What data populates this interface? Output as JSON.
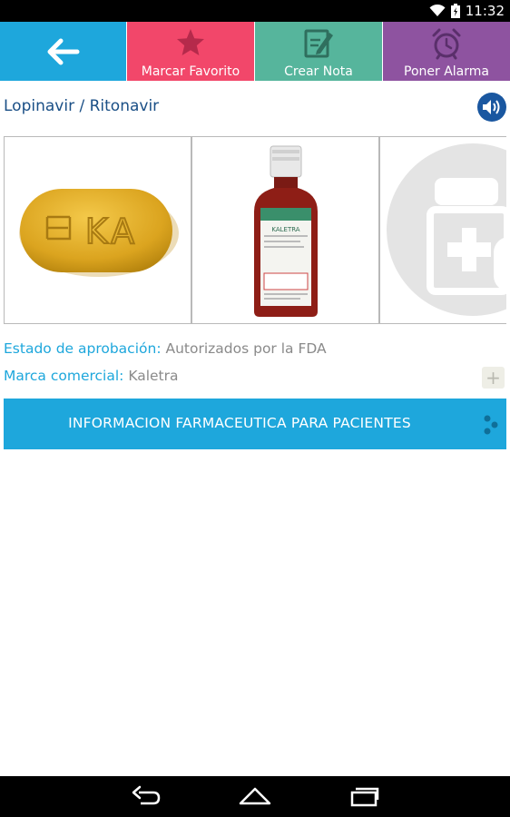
{
  "status_bar": {
    "time": "11:32",
    "icons": [
      "wifi-icon",
      "battery-icon"
    ]
  },
  "toolbar": {
    "back_icon": "arrow-left-icon",
    "favorite_label": "Marcar Favorito",
    "note_label": "Crear Nota",
    "alarm_label": "Poner Alarma",
    "colors": {
      "back": "#1ea7dc",
      "favorite": "#f2476a",
      "note": "#56b59c",
      "alarm": "#8e53a0"
    }
  },
  "drug": {
    "title": "Lopinavir / Ritonavir",
    "speaker_icon": "speaker-icon"
  },
  "gallery": {
    "pill_imprint": "KA",
    "bottle_label": "KALETRA"
  },
  "details": {
    "approval_label": "Estado de aprobación:",
    "approval_value": "Autorizados por la FDA",
    "brand_label": "Marca comercial:",
    "brand_value": "Kaletra",
    "expand_symbol": "+"
  },
  "info_button": {
    "label": "INFORMACION FARMACEUTICA PARA PACIENTES"
  },
  "nav": {
    "icons": [
      "back-nav-icon",
      "home-nav-icon",
      "recents-nav-icon"
    ]
  }
}
